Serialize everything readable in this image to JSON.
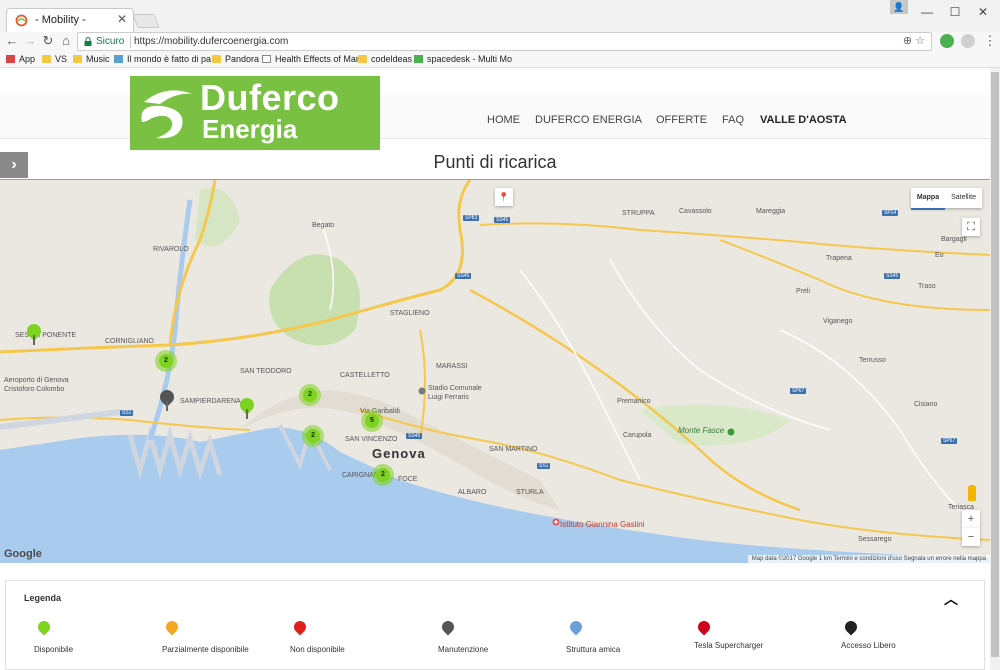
{
  "browser": {
    "tab_title": "- Mobility -",
    "secure_label": "Sicuro",
    "url": "https://mobility.dufercoenergia.com",
    "bookmarks": [
      "App",
      "VS",
      "Music",
      "Il mondo è fatto di pa",
      "Pandora",
      "Health Effects of Mari",
      "codeldeas",
      "spacedesk - Multi Mo"
    ]
  },
  "site": {
    "logo_line1": "Duferco",
    "logo_line2": "Energia",
    "nav": [
      "HOME",
      "DUFERCO ENERGIA",
      "OFFERTE",
      "FAQ",
      "VALLE D'AOSTA"
    ],
    "page_title": "Punti di ricarica"
  },
  "map": {
    "map_type": [
      "Mappa",
      "Satellite"
    ],
    "attribution": "Map data ©2017 Google   1 km        Termini e condizioni d'uso   Segnala un errore nella mappa",
    "google": "Google",
    "labels": {
      "genova": "Genova",
      "rivarolo": "RIVAROLO",
      "begato": "Begato",
      "staglieno": "STAGLIENO",
      "marassi": "MARASSI",
      "castelletto": "CASTELLETTO",
      "san_teodoro": "SAN TEODORO",
      "sampierdarena": "SAMPIERDARENA",
      "cornigliano": "CORNIGLIANO",
      "sestri": "SESTRI PONENTE",
      "aeroporto": "Aeroporto di Genova Cristoforo Colombo",
      "stadio": "Stadio Comunale Luigi Ferraris",
      "san_vincenzo": "SAN VINCENZO",
      "carignano": "CARIGNANO",
      "foce": "FOCE",
      "albaro": "ALBARO",
      "san_martino": "SAN MARTINO",
      "sturla": "STURLA",
      "gaslini": "Istituto Giannina Gaslini",
      "struppa": "STRUPPA",
      "cavassolo": "Cavassolo",
      "mareggia": "Mareggia",
      "bargagli": "Bargagli",
      "trapena": "Trapena",
      "eo": "Eo",
      "traso": "Traso",
      "preli": "Preli",
      "viganego": "Viganego",
      "terrusso": "Terrusso",
      "premanico": "Premanico",
      "carupola": "Carupola",
      "monte_fasce": "Monte Fasce",
      "cisiano": "Cisiano",
      "teriasca": "Teriasca",
      "sessarego": "Sessarego",
      "bogl": "Bogliasco",
      "garibaldi": "Via Garibaldi"
    },
    "clusters": [
      "2",
      "2",
      "2",
      "5",
      "2"
    ]
  },
  "legend": {
    "title": "Legenda",
    "items": [
      {
        "label": "Disponibile",
        "color": "#7ed321"
      },
      {
        "label": "Parzialmente disponibile",
        "color": "#f5a623"
      },
      {
        "label": "Non disponibile",
        "color": "#e02020"
      },
      {
        "label": "Manutenzione",
        "color": "#555555"
      },
      {
        "label": "Struttura amica",
        "color": "#6a9fd8"
      },
      {
        "label": "Tesla Supercharger",
        "color": "#d0021b"
      },
      {
        "label": "Accesso Libero",
        "color": "#222222"
      }
    ]
  },
  "colors": {
    "brand_green": "#7ac143",
    "sea": "#a9cbee"
  }
}
